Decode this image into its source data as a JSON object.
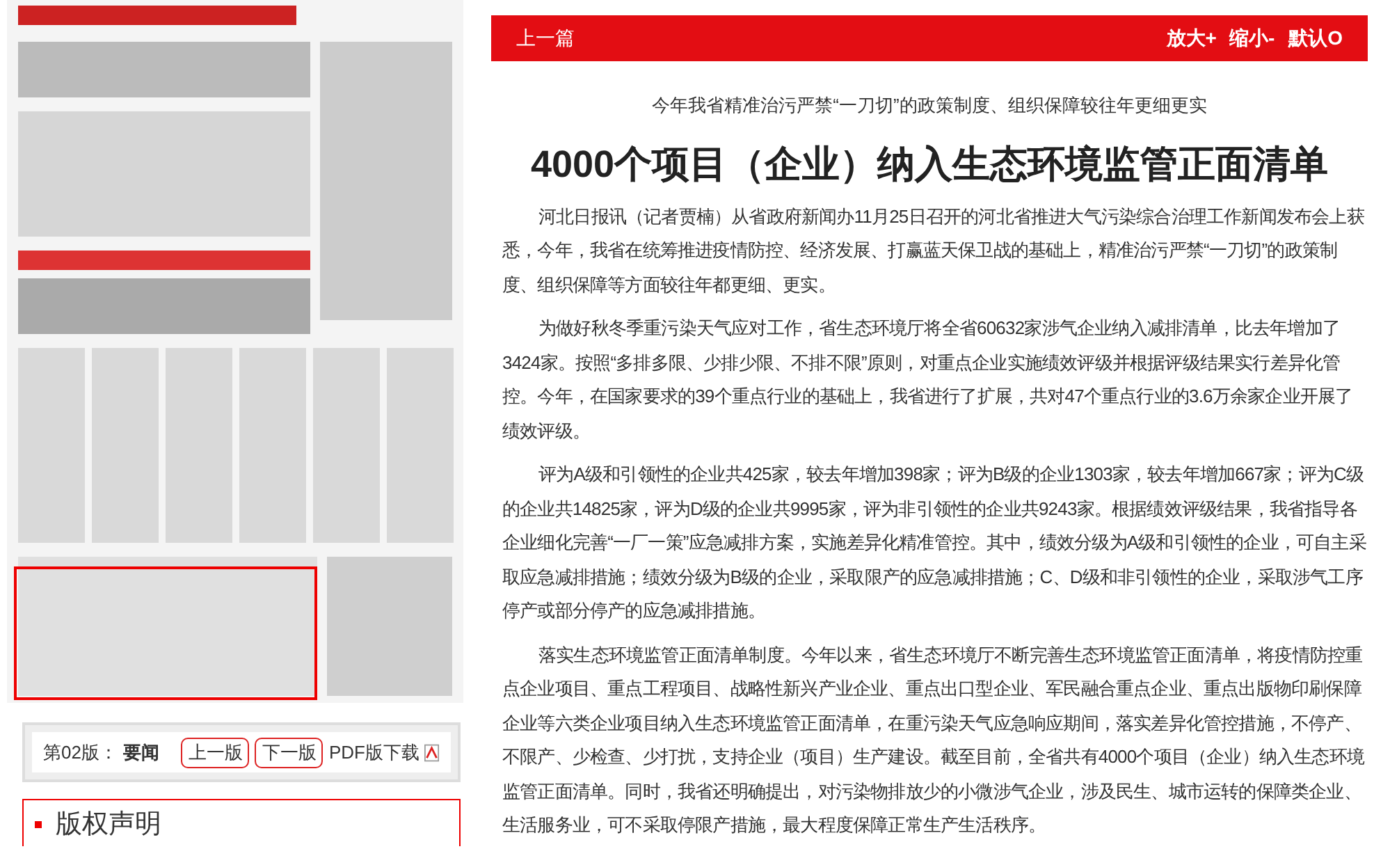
{
  "edition_bar": {
    "label": "第02版：",
    "section": "要闻",
    "prev": "上一版",
    "next": "下一版",
    "pdf": "PDF版下载"
  },
  "copyright_box": {
    "title": "版权声明"
  },
  "toolbar": {
    "prev_article": "上一篇",
    "zoom_in": "放大+",
    "zoom_out": "缩小-",
    "reset": "默认O"
  },
  "article": {
    "subtitle": "今年我省精准治污严禁“一刀切”的政策制度、组织保障较往年更细更实",
    "title": "4000个项目（企业）纳入生态环境监管正面清单",
    "paragraphs": [
      "河北日报讯（记者贾楠）从省政府新闻办11月25日召开的河北省推进大气污染综合治理工作新闻发布会上获悉，今年，我省在统筹推进疫情防控、经济发展、打赢蓝天保卫战的基础上，精准治污严禁“一刀切”的政策制度、组织保障等方面较往年都更细、更实。",
      "为做好秋冬季重污染天气应对工作，省生态环境厅将全省60632家涉气企业纳入减排清单，比去年增加了3424家。按照“多排多限、少排少限、不排不限”原则，对重点企业实施绩效评级并根据评级结果实行差异化管控。今年，在国家要求的39个重点行业的基础上，我省进行了扩展，共对47个重点行业的3.6万余家企业开展了绩效评级。",
      "评为A级和引领性的企业共425家，较去年增加398家；评为B级的企业1303家，较去年增加667家；评为C级的企业共14825家，评为D级的企业共9995家，评为非引领性的企业共9243家。根据绩效评级结果，我省指导各企业细化完善“一厂一策”应急减排方案，实施差异化精准管控。其中，绩效分级为A级和引领性的企业，可自主采取应急减排措施；绩效分级为B级的企业，采取限产的应急减排措施；C、D级和非引领性的企业，采取涉气工序停产或部分停产的应急减排措施。",
      "落实生态环境监管正面清单制度。今年以来，省生态环境厅不断完善生态环境监管正面清单，将疫情防控重点企业项目、重点工程项目、战略性新兴产业企业、重点出口型企业、军民融合重点企业、重点出版物印刷保障企业等六类企业项目纳入生态环境监管正面清单，在重污染天气应急响应期间，落实差异化管控措施，不停产、不限产、少检查、少打扰，支持企业（项目）生产建设。截至目前，全省共有4000个项目（企业）纳入生态环境监管正面清单。同时，我省还明确提出，对污染物排放少的小微涉气企业，涉及民生、城市运转的保障类企业、生活服务业，可不采取停限产措施，最大程度保障正常生产生活秩序。"
    ]
  }
}
